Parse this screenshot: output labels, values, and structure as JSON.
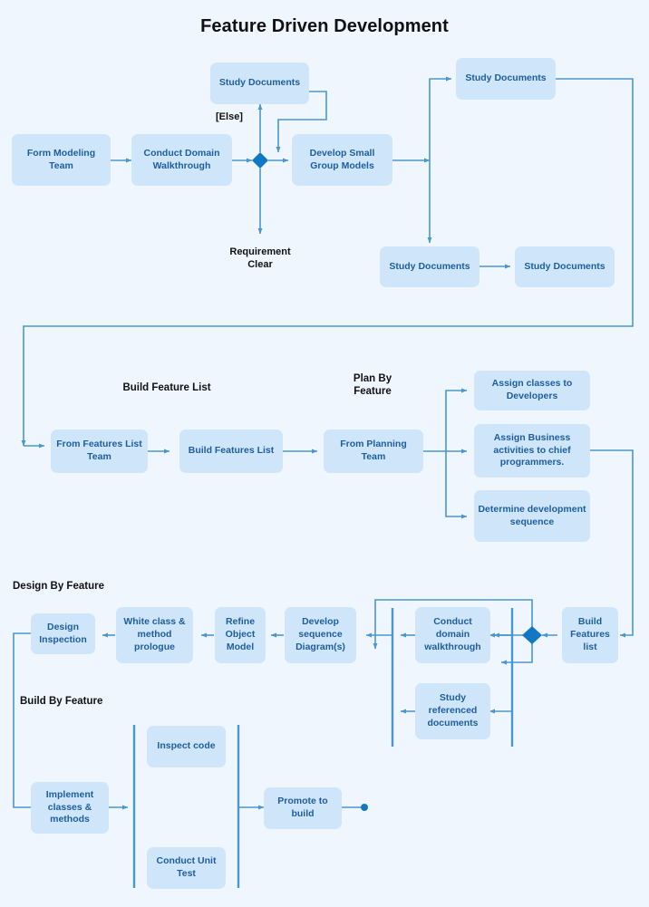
{
  "diagram": {
    "title": "Feature Driven Development",
    "background_color": "#eff6fd",
    "node_fill": "#cfe6fa",
    "node_text_color": "#1d5d9e",
    "connector_color": "#4a97cd",
    "decision_color": "#1378c4",
    "label_color": "#111111"
  },
  "phase_labels": {
    "build_feature_list": "Build Feature List",
    "plan_by_feature": "Plan By\nFeature",
    "design_by_feature": "Design By Feature",
    "build_by_feature": "Build By Feature"
  },
  "guards": {
    "else": "[Else]",
    "requirement_clear": "Requirement\nClear"
  },
  "nodes": {
    "form_modeling_team": "Form\nModeling\nTeam",
    "conduct_domain_walkthrough": "Conduct\nDomain\nWalkthrough",
    "study_documents_top": "Study\nDocuments",
    "develop_small_group_models": "Develop\nSmall\nGroup Models",
    "study_documents_right_top": "Study\nDocuments",
    "study_documents_right_mid": "Study\nDocuments",
    "study_documents_right_end": "Study\nDocuments",
    "from_features_list_team": "From Features\nList Team",
    "build_features_list": "Build Features\nList",
    "from_planning_team": "From Planning\nTeam",
    "assign_classes_to_developers": "Assign classes to\nDevelopers",
    "assign_business_activities": "Assign Business\nactivities to chief\nprogrammers.",
    "determine_development_sequence": "Determine\ndevelopment\nsequence",
    "build_features_list_2": "Build\nFeatures\nlist",
    "conduct_domain_walkthrough_2": "Conduct\ndomain\nwalkthrough",
    "study_referenced_documents": "Study\nreferenced\ndocuments",
    "develop_sequence_diagrams": "Develop\nsequence\nDiagram(s)",
    "refine_object_model": "Refine\nObject\nModel",
    "white_class_method_prologue": "White class\n& method\nprologue",
    "design_inspection": "Design\nInspection",
    "implement_classes_methods": "Implement\nclasses &\nmethods",
    "inspect_code": "Inspect\ncode",
    "conduct_unit_test": "Conduct\nUnit Test",
    "promote_to_build": "Promote\nto build"
  }
}
